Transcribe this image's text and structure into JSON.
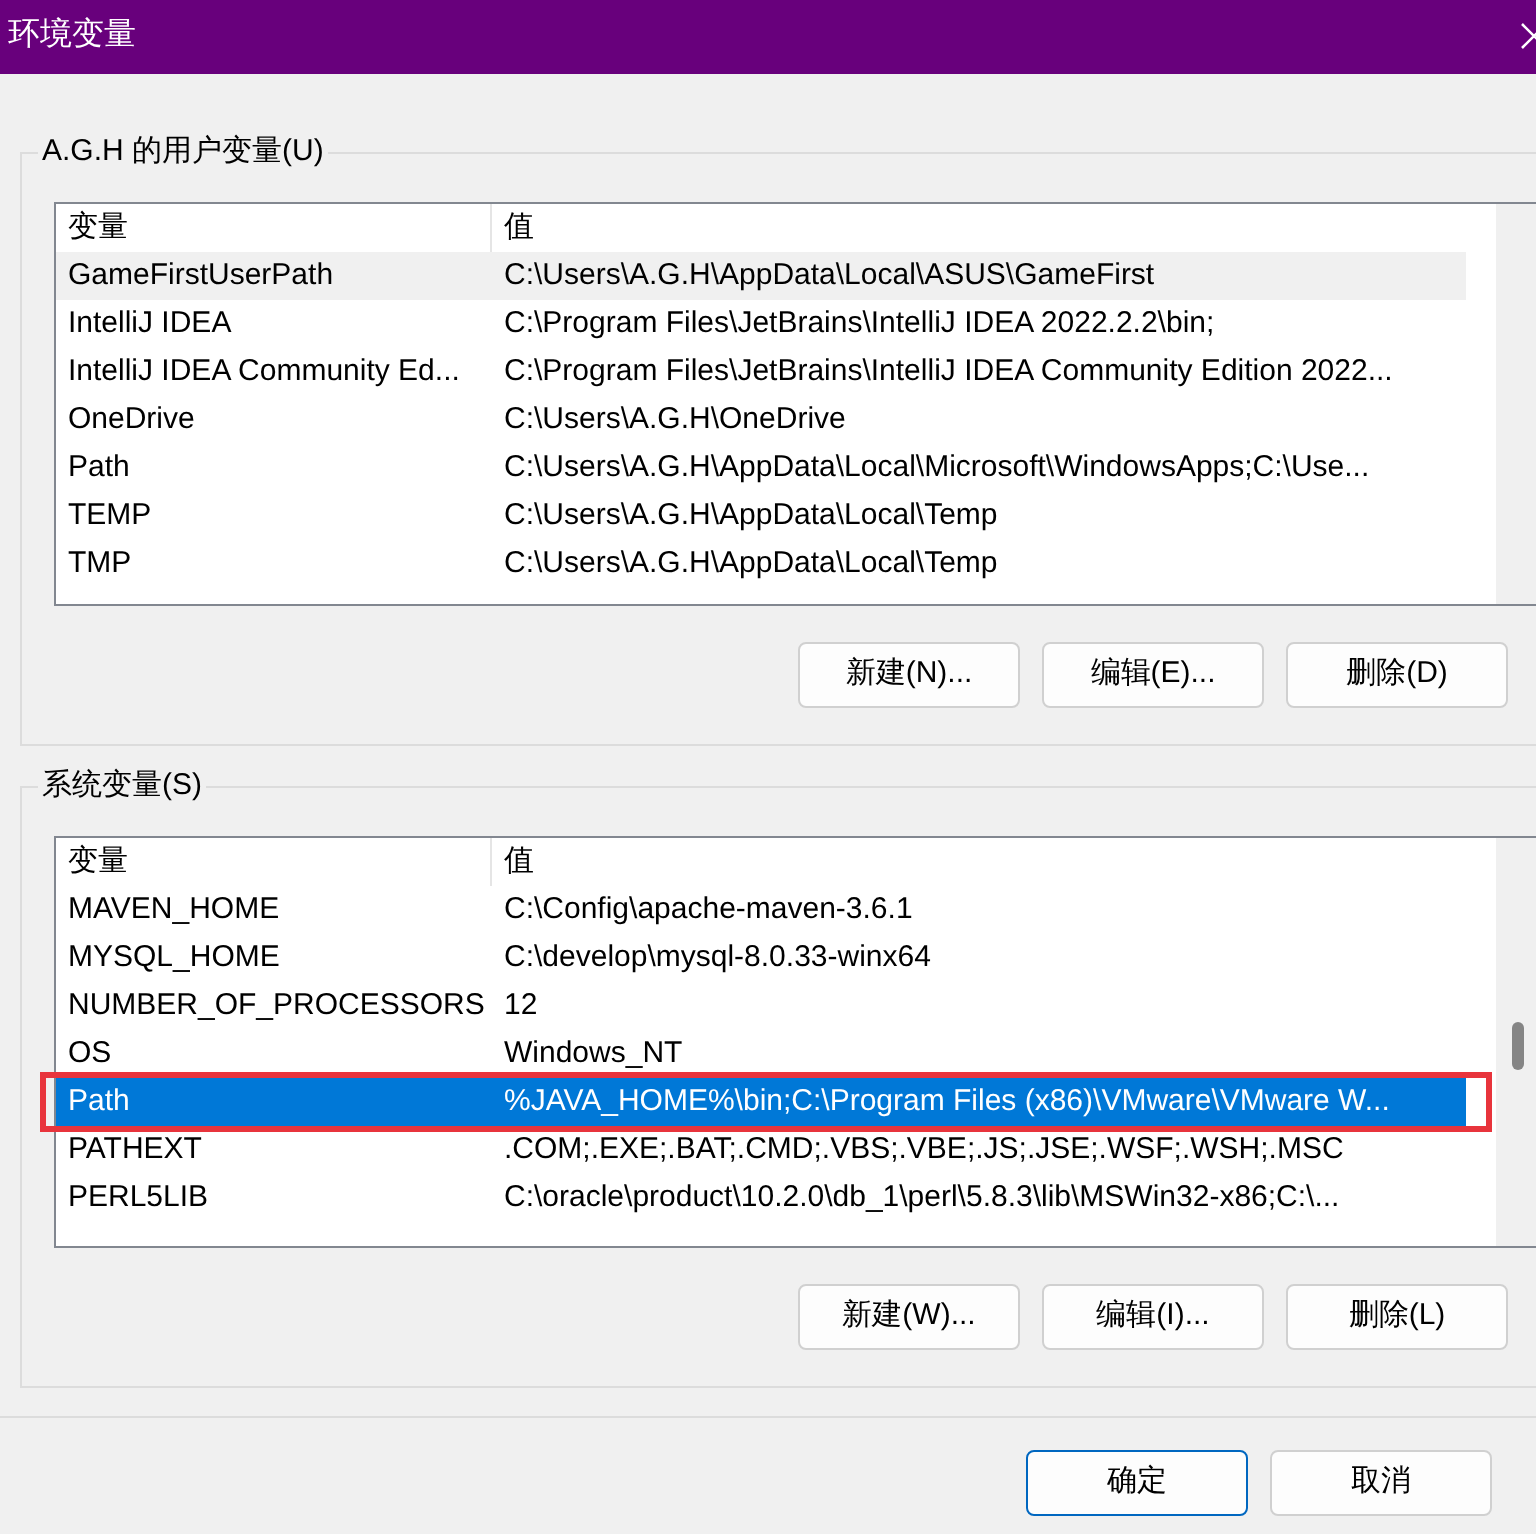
{
  "window": {
    "title": "环境变量"
  },
  "user_variables": {
    "label": "A.G.H 的用户变量(U)",
    "columns": [
      "变量",
      "值"
    ],
    "rows": [
      {
        "name": "GameFirstUserPath",
        "value": "C:\\Users\\A.G.H\\AppData\\Local\\ASUS\\GameFirst",
        "selected": false,
        "hovered": true,
        "marked": false
      },
      {
        "name": "IntelliJ IDEA",
        "value": "C:\\Program Files\\JetBrains\\IntelliJ IDEA 2022.2.2\\bin;",
        "selected": false,
        "hovered": false,
        "marked": false
      },
      {
        "name": "IntelliJ IDEA Community Ed...",
        "value": "C:\\Program Files\\JetBrains\\IntelliJ IDEA Community Edition 2022...",
        "selected": false,
        "hovered": false,
        "marked": false
      },
      {
        "name": "OneDrive",
        "value": "C:\\Users\\A.G.H\\OneDrive",
        "selected": false,
        "hovered": false,
        "marked": false
      },
      {
        "name": "Path",
        "value": "C:\\Users\\A.G.H\\AppData\\Local\\Microsoft\\WindowsApps;C:\\Use...",
        "selected": false,
        "hovered": false,
        "marked": false
      },
      {
        "name": "TEMP",
        "value": "C:\\Users\\A.G.H\\AppData\\Local\\Temp",
        "selected": false,
        "hovered": false,
        "marked": false
      },
      {
        "name": "TMP",
        "value": "C:\\Users\\A.G.H\\AppData\\Local\\Temp",
        "selected": false,
        "hovered": false,
        "marked": false
      }
    ],
    "buttons": [
      "新建(N)...",
      "编辑(E)...",
      "删除(D)"
    ]
  },
  "system_variables": {
    "label": "系统变量(S)",
    "columns": [
      "变量",
      "值"
    ],
    "rows": [
      {
        "name": "MAVEN_HOME",
        "value": "C:\\Config\\apache-maven-3.6.1",
        "selected": false,
        "hovered": false,
        "marked": false
      },
      {
        "name": "MYSQL_HOME",
        "value": "C:\\develop\\mysql-8.0.33-winx64",
        "selected": false,
        "hovered": false,
        "marked": false
      },
      {
        "name": "NUMBER_OF_PROCESSORS",
        "value": "12",
        "selected": false,
        "hovered": false,
        "marked": false
      },
      {
        "name": "OS",
        "value": "Windows_NT",
        "selected": false,
        "hovered": false,
        "marked": false
      },
      {
        "name": "Path",
        "value": "%JAVA_HOME%\\bin;C:\\Program Files (x86)\\VMware\\VMware W...",
        "selected": true,
        "hovered": false,
        "marked": true
      },
      {
        "name": "PATHEXT",
        "value": ".COM;.EXE;.BAT;.CMD;.VBS;.VBE;.JS;.JSE;.WSF;.WSH;.MSC",
        "selected": false,
        "hovered": false,
        "marked": false
      },
      {
        "name": "PERL5LIB",
        "value": "C:\\oracle\\product\\10.2.0\\db_1\\perl\\5.8.3\\lib\\MSWin32-x86;C:\\...",
        "selected": false,
        "hovered": false,
        "marked": false
      }
    ],
    "buttons": [
      "新建(W)...",
      "编辑(I)...",
      "删除(L)"
    ]
  },
  "dialog_buttons": [
    {
      "label": "确定",
      "default": true
    },
    {
      "label": "取消",
      "default": false
    }
  ]
}
